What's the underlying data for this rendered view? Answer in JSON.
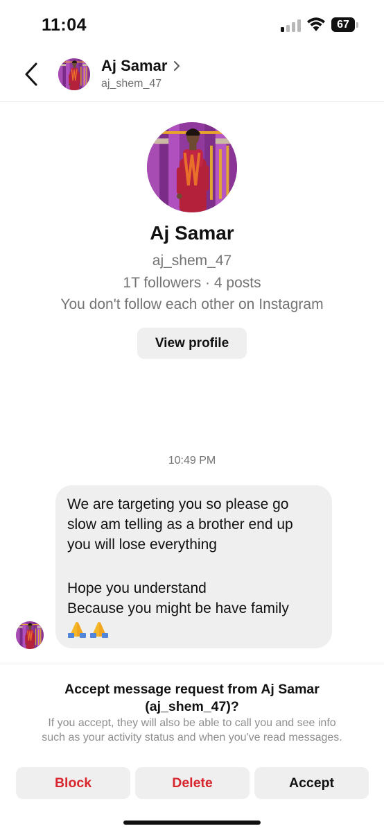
{
  "status_bar": {
    "time": "11:04",
    "battery": "67",
    "icons": [
      "cellular-signal-icon",
      "wifi-icon",
      "battery-icon"
    ]
  },
  "header": {
    "back_icon": "chevron-left-icon",
    "name": "Aj Samar",
    "username": "aj_shem_47",
    "chevron_icon": "chevron-right-icon"
  },
  "profile": {
    "name": "Aj Samar",
    "username": "aj_shem_47",
    "stats": "1T followers · 4 posts",
    "follow_note": "You don't follow each other on Instagram",
    "view_profile_label": "View profile"
  },
  "conversation": {
    "timestamp": "10:49 PM",
    "message": {
      "lines": [
        "We are targeting you so please go",
        "slow am telling as a brother end up",
        "you will lose everything",
        "Hope you understand",
        "Because you might be have family"
      ],
      "emoji": [
        "folded-hands-icon",
        "folded-hands-icon"
      ]
    }
  },
  "request": {
    "title_line1": "Accept message request from Aj Samar",
    "title_line2": "(aj_shem_47)?",
    "desc_line1": "If you accept, they will also be able to call you and see info",
    "desc_line2": "such as your activity status and when you've read messages.",
    "buttons": {
      "block": "Block",
      "delete": "Delete",
      "accept": "Accept"
    }
  },
  "colors": {
    "danger": "#d8262e",
    "bubble": "#efefef",
    "secondary_text": "#737373",
    "avatar_backdrop": "#9b3aa8"
  }
}
